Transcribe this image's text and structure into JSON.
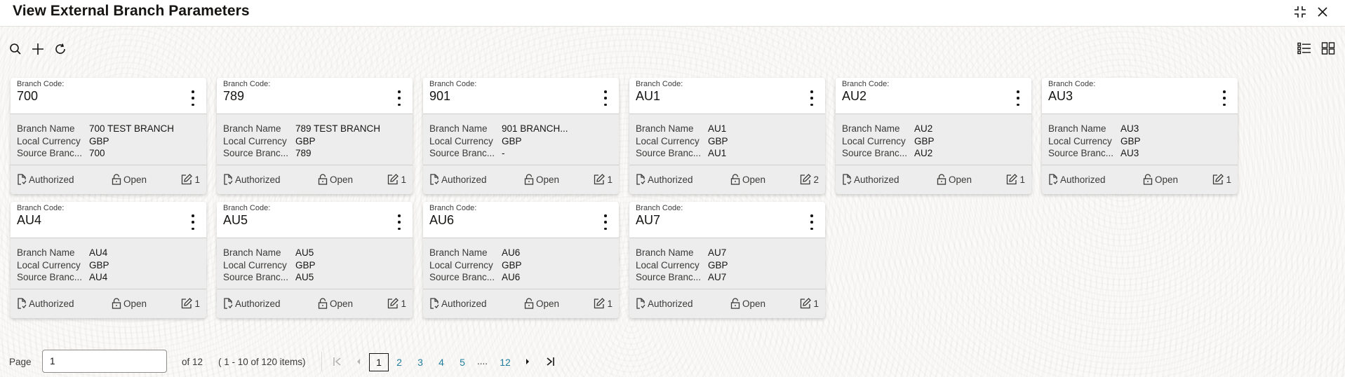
{
  "header": {
    "title": "View External Branch Parameters",
    "icons": [
      "minimize-icon",
      "close-icon"
    ]
  },
  "toolbar": {
    "left_icons": [
      "search-icon",
      "add-icon",
      "refresh-icon"
    ],
    "right_icons": [
      "list-view-icon",
      "grid-view-icon"
    ]
  },
  "card_labels": {
    "code": "Branch Code:",
    "branch_name": "Branch Name",
    "local_currency": "Local Currency",
    "source_branch": "Source Branc..."
  },
  "cards": [
    {
      "code": "700",
      "branch_name": "700 TEST BRANCH",
      "local_currency": "GBP",
      "source_branch": "700",
      "auth_status": "Authorized",
      "record_status": "Open",
      "mod_no": "1"
    },
    {
      "code": "789",
      "branch_name": "789 TEST BRANCH",
      "local_currency": "GBP",
      "source_branch": "789",
      "auth_status": "Authorized",
      "record_status": "Open",
      "mod_no": "1"
    },
    {
      "code": "901",
      "branch_name": "901 BRANCH...",
      "local_currency": "GBP",
      "source_branch": "-",
      "auth_status": "Authorized",
      "record_status": "Open",
      "mod_no": "1"
    },
    {
      "code": "AU1",
      "branch_name": "AU1",
      "local_currency": "GBP",
      "source_branch": "AU1",
      "auth_status": "Authorized",
      "record_status": "Open",
      "mod_no": "2"
    },
    {
      "code": "AU2",
      "branch_name": "AU2",
      "local_currency": "GBP",
      "source_branch": "AU2",
      "auth_status": "Authorized",
      "record_status": "Open",
      "mod_no": "1"
    },
    {
      "code": "AU3",
      "branch_name": "AU3",
      "local_currency": "GBP",
      "source_branch": "AU3",
      "auth_status": "Authorized",
      "record_status": "Open",
      "mod_no": "1"
    },
    {
      "code": "AU4",
      "branch_name": "AU4",
      "local_currency": "GBP",
      "source_branch": "AU4",
      "auth_status": "Authorized",
      "record_status": "Open",
      "mod_no": "1"
    },
    {
      "code": "AU5",
      "branch_name": "AU5",
      "local_currency": "GBP",
      "source_branch": "AU5",
      "auth_status": "Authorized",
      "record_status": "Open",
      "mod_no": "1"
    },
    {
      "code": "AU6",
      "branch_name": "AU6",
      "local_currency": "GBP",
      "source_branch": "AU6",
      "auth_status": "Authorized",
      "record_status": "Open",
      "mod_no": "1"
    },
    {
      "code": "AU7",
      "branch_name": "AU7",
      "local_currency": "GBP",
      "source_branch": "AU7",
      "auth_status": "Authorized",
      "record_status": "Open",
      "mod_no": "1"
    }
  ],
  "pagination": {
    "page_label": "Page",
    "page_value": "1",
    "of_label": "of 12",
    "range_label": "( 1 - 10 of 120 items)",
    "pages": [
      "1",
      "2",
      "3",
      "4",
      "5"
    ],
    "ellipsis": "....",
    "last_page": "12",
    "current_page": "1"
  },
  "colors": {
    "link": "#227e9e",
    "text": "#161513",
    "card_body": "#ededed"
  }
}
